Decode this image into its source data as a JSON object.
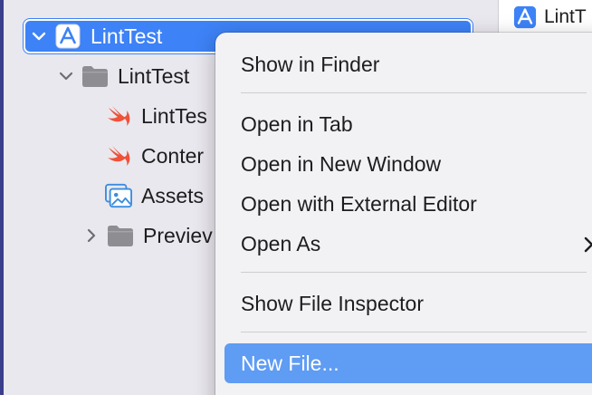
{
  "navigator": {
    "project": {
      "label": "LintTest",
      "icon": "xcode-project-icon",
      "expanded": true
    },
    "group": {
      "label": "LintTest",
      "icon": "folder-icon",
      "expanded": true
    },
    "items": [
      {
        "label": "LintTes",
        "icon": "swift-file-icon"
      },
      {
        "label": "Conter",
        "icon": "swift-file-icon"
      },
      {
        "label": "Assets",
        "icon": "asset-catalog-icon"
      }
    ],
    "preview_group": {
      "label": "Previev",
      "icon": "folder-icon",
      "expanded": false
    }
  },
  "editor": {
    "tab_label": "LintT",
    "tab_icon": "xcode-project-icon"
  },
  "context_menu": {
    "items": [
      {
        "label": "Show in Finder"
      },
      {
        "label": "Open in Tab"
      },
      {
        "label": "Open in New Window"
      },
      {
        "label": "Open with External Editor"
      },
      {
        "label": "Open As",
        "has_submenu": true
      },
      {
        "label": "Show File Inspector"
      },
      {
        "label": "New File...",
        "highlighted": true
      }
    ]
  },
  "colors": {
    "selection": "#3d82f6",
    "menu_highlight": "#5f9cf3",
    "swift_orange": "#f05138",
    "folder_gray": "#8e8d92",
    "asset_blue": "#3a8de0"
  }
}
